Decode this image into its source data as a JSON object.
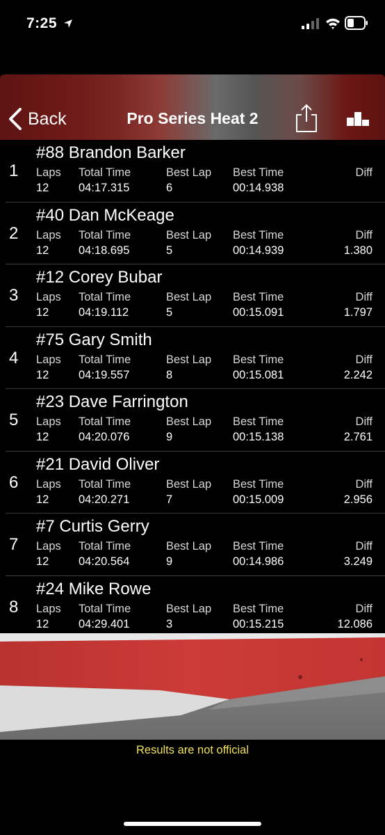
{
  "status_bar": {
    "time": "7:25"
  },
  "nav": {
    "back_label": "Back",
    "title": "Pro Series Heat 2"
  },
  "columns": {
    "laps": "Laps",
    "total_time": "Total Time",
    "best_lap": "Best Lap",
    "best_time": "Best Time",
    "diff": "Diff"
  },
  "results": [
    {
      "pos": "1",
      "driver": "#88 Brandon Barker",
      "laps": "12",
      "total_time": "04:17.315",
      "best_lap": "6",
      "best_time": "00:14.938",
      "diff": ""
    },
    {
      "pos": "2",
      "driver": "#40 Dan McKeage",
      "laps": "12",
      "total_time": "04:18.695",
      "best_lap": "5",
      "best_time": "00:14.939",
      "diff": "1.380"
    },
    {
      "pos": "3",
      "driver": "#12 Corey Bubar",
      "laps": "12",
      "total_time": "04:19.112",
      "best_lap": "5",
      "best_time": "00:15.091",
      "diff": "1.797"
    },
    {
      "pos": "4",
      "driver": "#75 Gary Smith",
      "laps": "12",
      "total_time": "04:19.557",
      "best_lap": "8",
      "best_time": "00:15.081",
      "diff": "2.242"
    },
    {
      "pos": "5",
      "driver": "#23 Dave Farrington",
      "laps": "12",
      "total_time": "04:20.076",
      "best_lap": "9",
      "best_time": "00:15.138",
      "diff": "2.761"
    },
    {
      "pos": "6",
      "driver": "#21 David Oliver",
      "laps": "12",
      "total_time": "04:20.271",
      "best_lap": "7",
      "best_time": "00:15.009",
      "diff": "2.956"
    },
    {
      "pos": "7",
      "driver": "#7 Curtis Gerry",
      "laps": "12",
      "total_time": "04:20.564",
      "best_lap": "9",
      "best_time": "00:14.986",
      "diff": "3.249"
    },
    {
      "pos": "8",
      "driver": "#24 Mike Rowe",
      "laps": "12",
      "total_time": "04:29.401",
      "best_lap": "3",
      "best_time": "00:15.215",
      "diff": "12.086"
    }
  ],
  "footer": {
    "note": "Results are not official"
  },
  "colors": {
    "nav_red": "#6e1a18",
    "note_yellow": "#f1e15c",
    "background": "#000000"
  },
  "icons": [
    "location-arrow-icon",
    "cellular-signal-icon",
    "wifi-icon",
    "battery-icon",
    "chevron-left-icon",
    "share-icon",
    "podium-icon"
  ]
}
